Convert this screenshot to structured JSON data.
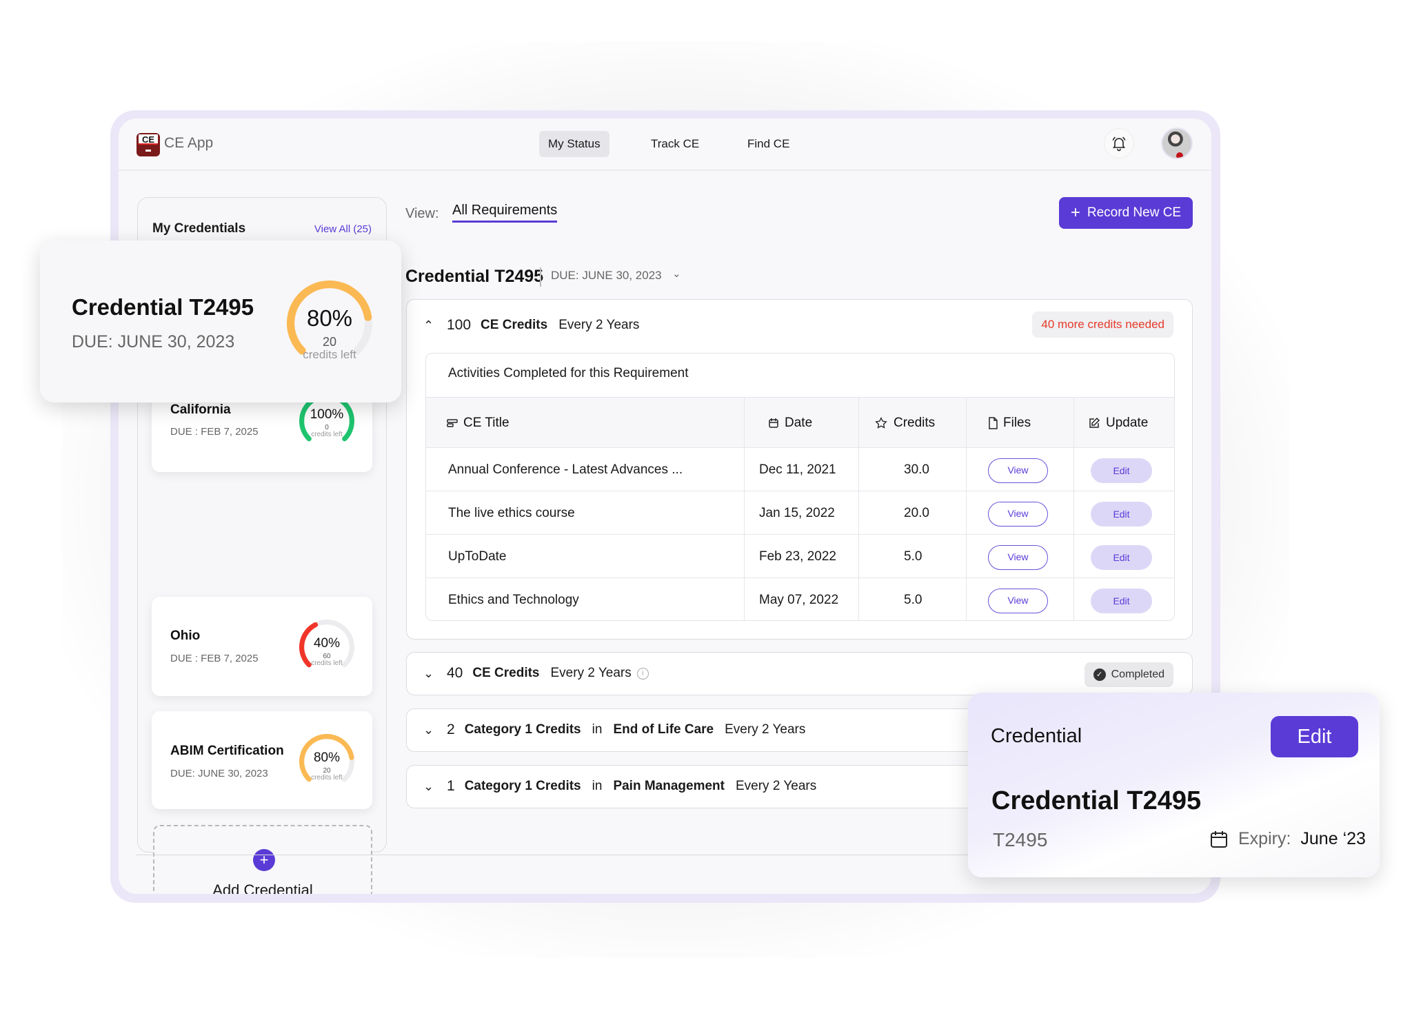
{
  "app": {
    "logo_text": "CE",
    "name": "CE App"
  },
  "nav": [
    {
      "label": "My Status",
      "active": true
    },
    {
      "label": "Track CE",
      "active": false
    },
    {
      "label": "Find CE",
      "active": false
    }
  ],
  "header_icons": {
    "bell": "bell-icon",
    "avatar": "user-avatar"
  },
  "sidebar": {
    "title": "My Credentials",
    "view_all": "View All (25)",
    "credentials": [
      {
        "name": "California",
        "due": "DUE : FEB 7, 2025",
        "percent": 100,
        "percent_label": "100%",
        "credits_left": "0",
        "credits_left_label": "credits left",
        "color": "#1fc46f"
      },
      {
        "name": "Ohio",
        "due": "DUE : FEB 7, 2025",
        "percent": 40,
        "percent_label": "40%",
        "credits_left": "60",
        "credits_left_label": "credits left",
        "color": "#f0352a"
      },
      {
        "name": "ABIM Certification",
        "due": "DUE: JUNE 30, 2023",
        "percent": 80,
        "percent_label": "80%",
        "credits_left": "20",
        "credits_left_label": "credits left",
        "color": "#fbb954"
      }
    ],
    "add_label": "Add Credential"
  },
  "featured_card": {
    "name": "Credential T2495",
    "due": "DUE: JUNE 30, 2023",
    "percent": 80,
    "percent_label": "80%",
    "credits_left": "20",
    "credits_left_label": "credits left",
    "color": "#fbb954"
  },
  "main": {
    "view_label": "View:",
    "view_value": "All Requirements",
    "record_button": "Record New CE",
    "credential_title": "Credential T2495",
    "credential_due": "DUE: JUNE 30, 2023",
    "requirements": [
      {
        "expanded": true,
        "count": "100",
        "type": "CE Credits",
        "period": "Every 2 Years",
        "badge": "40 more credits needed",
        "activities_title": "Activities Completed for this Requirement",
        "columns": [
          "CE Title",
          "Date",
          "Credits",
          "Files",
          "Update"
        ],
        "rows": [
          {
            "title": "Annual Conference - Latest Advances ...",
            "date": "Dec 11, 2021",
            "credits": "30.0",
            "files": "View",
            "update": "Edit"
          },
          {
            "title": "The live ethics course",
            "date": "Jan 15, 2022",
            "credits": "20.0",
            "files": "View",
            "update": "Edit"
          },
          {
            "title": "UpToDate",
            "date": "Feb 23, 2022",
            "credits": "5.0",
            "files": "View",
            "update": "Edit"
          },
          {
            "title": "Ethics and Technology",
            "date": "May 07, 2022",
            "credits": "5.0",
            "files": "View",
            "update": "Edit"
          }
        ]
      },
      {
        "expanded": false,
        "count": "40",
        "type": "CE Credits",
        "period": "Every 2 Years",
        "badge": "Completed"
      },
      {
        "expanded": false,
        "count": "2",
        "type": "Category 1 Credits",
        "connector": "in",
        "topic": "End of Life Care",
        "period": "Every 2 Years"
      },
      {
        "expanded": false,
        "count": "1",
        "type": "Category 1 Credits",
        "connector": "in",
        "topic": "Pain Management",
        "period": "Every 2 Years"
      }
    ]
  },
  "detail_card": {
    "label": "Credential",
    "edit_button": "Edit",
    "title": "Credential T2495",
    "id": "T2495",
    "expiry_label": "Expiry:",
    "expiry_value": "June ‘23"
  },
  "colors": {
    "accent": "#5a3bd6",
    "warning": "#e53a2a",
    "success": "#1fc46f",
    "caution": "#fbb954"
  }
}
